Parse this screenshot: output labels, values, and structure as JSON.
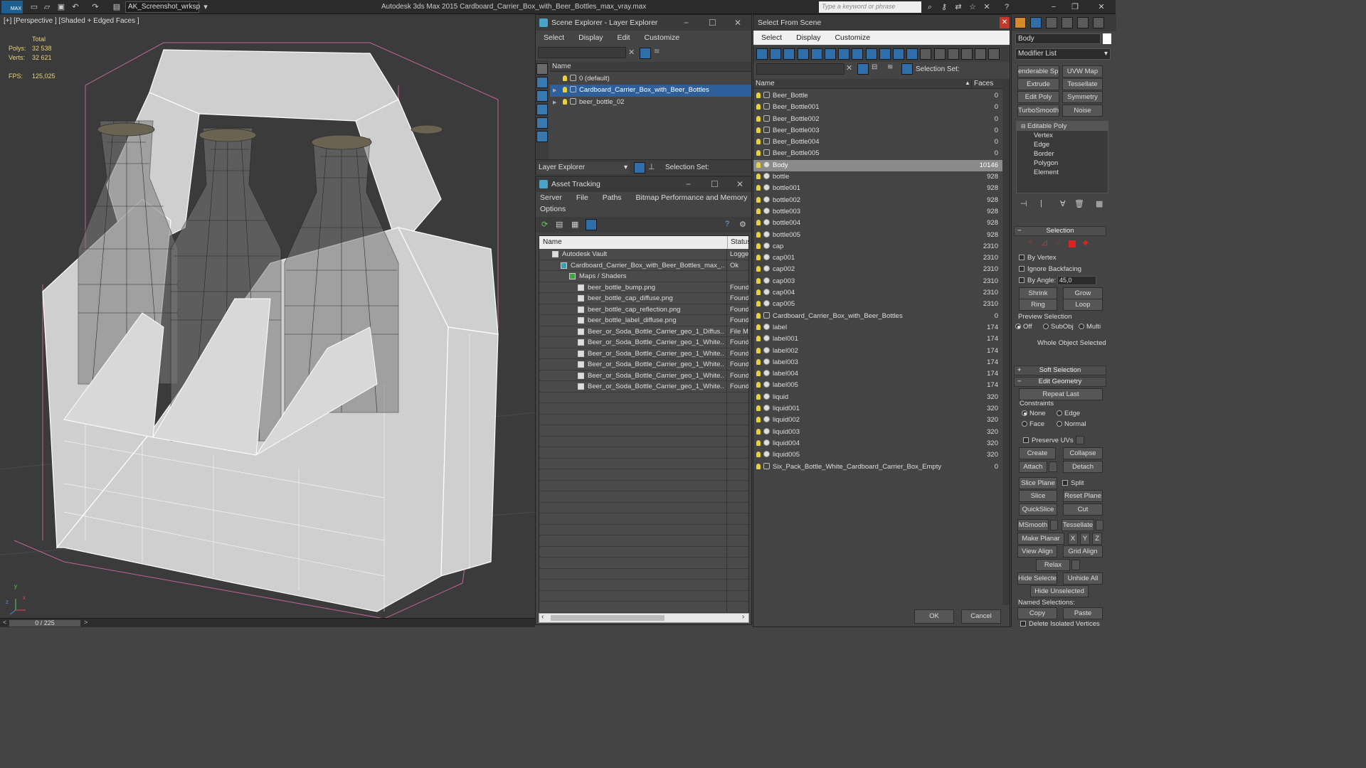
{
  "app": {
    "title": "Autodesk 3ds Max  2015    Cardboard_Carrier_Box_with_Beer_Bottles_max_vray.max",
    "workspace": "AK_Screenshot_wrksp",
    "search_placeholder": "Type a keyword or phrase",
    "logo": "MAX"
  },
  "viewport": {
    "label": "[+] [Perspective ] [Shaded + Edged Faces ]",
    "stats_header": "Total",
    "polys_label": "Polys:",
    "polys_value": "32 538",
    "verts_label": "Verts:",
    "verts_value": "32 621",
    "fps_label": "FPS:",
    "fps_value": "125,025",
    "axis_x": "x",
    "axis_y": "y",
    "axis_z": "z"
  },
  "timeline": {
    "frame": "0 / 225",
    "prev": "<",
    "next": ">"
  },
  "scene_explorer": {
    "title": "Scene Explorer - Layer Explorer",
    "menu": [
      "Select",
      "Display",
      "Edit",
      "Customize"
    ],
    "col_name": "Name",
    "layers": [
      {
        "label": "0 (default)",
        "expand": ""
      },
      {
        "label": "Cardboard_Carrier_Box_with_Beer_Bottles",
        "expand": "▶"
      },
      {
        "label": "beer_bottle_02",
        "expand": "▶"
      }
    ],
    "footer_dropdown": "Layer Explorer",
    "selection_set": "Selection Set:"
  },
  "asset_tracking": {
    "title": "Asset Tracking",
    "menu": [
      "Server",
      "File",
      "Paths",
      "Bitmap Performance and Memory"
    ],
    "menu2": "Options",
    "col_name": "Name",
    "col_status": "Status",
    "rows": [
      {
        "name": "Autodesk Vault",
        "status": "Logged",
        "indent": 0
      },
      {
        "name": "Cardboard_Carrier_Box_with_Beer_Bottles_max_...",
        "status": "Ok",
        "indent": 1
      },
      {
        "name": "Maps / Shaders",
        "status": "",
        "indent": 2
      },
      {
        "name": "beer_bottle_bump.png",
        "status": "Found",
        "indent": 3
      },
      {
        "name": "beer_bottle_cap_diffuse.png",
        "status": "Found",
        "indent": 3
      },
      {
        "name": "beer_bottle_cap_reflection.png",
        "status": "Found",
        "indent": 3
      },
      {
        "name": "beer_bottle_label_diffuse.png",
        "status": "Found",
        "indent": 3
      },
      {
        "name": "Beer_or_Soda_Bottle_Carrier_geo_1_Diffus...",
        "status": "File Mis",
        "indent": 3
      },
      {
        "name": "Beer_or_Soda_Bottle_Carrier_geo_1_White...",
        "status": "Found",
        "indent": 3
      },
      {
        "name": "Beer_or_Soda_Bottle_Carrier_geo_1_White...",
        "status": "Found",
        "indent": 3
      },
      {
        "name": "Beer_or_Soda_Bottle_Carrier_geo_1_White...",
        "status": "Found",
        "indent": 3
      },
      {
        "name": "Beer_or_Soda_Bottle_Carrier_geo_1_White...",
        "status": "Found",
        "indent": 3
      },
      {
        "name": "Beer_or_Soda_Bottle_Carrier_geo_1_White...",
        "status": "Found",
        "indent": 3
      }
    ]
  },
  "select_from_scene": {
    "title": "Select From Scene",
    "menu": [
      "Select",
      "Display",
      "Customize"
    ],
    "selection_set": "Selection Set:",
    "col_name": "Name",
    "col_faces": "Faces",
    "sort_arrow": "▲",
    "items": [
      {
        "name": "Beer_Bottle",
        "faces": "0",
        "kind": "group"
      },
      {
        "name": "Beer_Bottle001",
        "faces": "0",
        "kind": "group"
      },
      {
        "name": "Beer_Bottle002",
        "faces": "0",
        "kind": "group"
      },
      {
        "name": "Beer_Bottle003",
        "faces": "0",
        "kind": "group"
      },
      {
        "name": "Beer_Bottle004",
        "faces": "0",
        "kind": "group"
      },
      {
        "name": "Beer_Bottle005",
        "faces": "0",
        "kind": "group"
      },
      {
        "name": "Body",
        "faces": "10146",
        "kind": "mesh"
      },
      {
        "name": "bottle",
        "faces": "928",
        "kind": "mesh"
      },
      {
        "name": "bottle001",
        "faces": "928",
        "kind": "mesh"
      },
      {
        "name": "bottle002",
        "faces": "928",
        "kind": "mesh"
      },
      {
        "name": "bottle003",
        "faces": "928",
        "kind": "mesh"
      },
      {
        "name": "bottle004",
        "faces": "928",
        "kind": "mesh"
      },
      {
        "name": "bottle005",
        "faces": "928",
        "kind": "mesh"
      },
      {
        "name": "cap",
        "faces": "2310",
        "kind": "mesh"
      },
      {
        "name": "cap001",
        "faces": "2310",
        "kind": "mesh"
      },
      {
        "name": "cap002",
        "faces": "2310",
        "kind": "mesh"
      },
      {
        "name": "cap003",
        "faces": "2310",
        "kind": "mesh"
      },
      {
        "name": "cap004",
        "faces": "2310",
        "kind": "mesh"
      },
      {
        "name": "cap005",
        "faces": "2310",
        "kind": "mesh"
      },
      {
        "name": "Cardboard_Carrier_Box_with_Beer_Bottles",
        "faces": "0",
        "kind": "group"
      },
      {
        "name": "label",
        "faces": "174",
        "kind": "mesh"
      },
      {
        "name": "label001",
        "faces": "174",
        "kind": "mesh"
      },
      {
        "name": "label002",
        "faces": "174",
        "kind": "mesh"
      },
      {
        "name": "label003",
        "faces": "174",
        "kind": "mesh"
      },
      {
        "name": "label004",
        "faces": "174",
        "kind": "mesh"
      },
      {
        "name": "label005",
        "faces": "174",
        "kind": "mesh"
      },
      {
        "name": "liquid",
        "faces": "320",
        "kind": "mesh"
      },
      {
        "name": "liquid001",
        "faces": "320",
        "kind": "mesh"
      },
      {
        "name": "liquid002",
        "faces": "320",
        "kind": "mesh"
      },
      {
        "name": "liquid003",
        "faces": "320",
        "kind": "mesh"
      },
      {
        "name": "liquid004",
        "faces": "320",
        "kind": "mesh"
      },
      {
        "name": "liquid005",
        "faces": "320",
        "kind": "mesh"
      },
      {
        "name": "Six_Pack_Bottle_White_Cardboard_Carrier_Box_Empty",
        "faces": "0",
        "kind": "group"
      }
    ],
    "ok": "OK",
    "cancel": "Cancel"
  },
  "command_panel": {
    "object_name": "Body",
    "modifier_list": "Modifier List",
    "mod_buttons": [
      "enderable Spli",
      "UVW Map",
      "Extrude",
      "Tessellate",
      "Edit Poly",
      "Symmetry",
      "TurboSmooth",
      "Noise"
    ],
    "stack": [
      "Editable Poly",
      "Vertex",
      "Edge",
      "Border",
      "Polygon",
      "Element"
    ],
    "selection": {
      "title": "Selection",
      "by_vertex": "By Vertex",
      "ignore_backfacing": "Ignore Backfacing",
      "by_angle": "By Angle:",
      "angle_value": "45,0",
      "shrink": "Shrink",
      "grow": "Grow",
      "ring": "Ring",
      "loop": "Loop",
      "preview_label": "Preview Selection",
      "preview_off": "Off",
      "preview_subobj": "SubObj",
      "preview_multi": "Multi",
      "status": "Whole Object Selected"
    },
    "soft_selection": "Soft Selection",
    "edit_geometry": {
      "title": "Edit Geometry",
      "repeat_last": "Repeat Last",
      "constraints": "Constraints",
      "none": "None",
      "edge": "Edge",
      "face": "Face",
      "normal": "Normal",
      "preserve_uvs": "Preserve UVs",
      "create": "Create",
      "collapse": "Collapse",
      "attach": "Attach",
      "detach": "Detach",
      "slice_plane": "Slice Plane",
      "split": "Split",
      "slice": "Slice",
      "reset_plane": "Reset Plane",
      "quickslice": "QuickSlice",
      "cut": "Cut",
      "msmooth": "MSmooth",
      "tessellate": "Tessellate",
      "make_planar": "Make Planar",
      "x": "X",
      "y": "Y",
      "z": "Z",
      "view_align": "View Align",
      "grid_align": "Grid Align",
      "relax": "Relax",
      "hide_selected": "Hide Selected",
      "unhide_all": "Unhide All",
      "hide_unselected": "Hide Unselected",
      "named_selections": "Named Selections:",
      "copy": "Copy",
      "paste": "Paste",
      "delete_isolated": "Delete Isolated Vertices"
    }
  }
}
